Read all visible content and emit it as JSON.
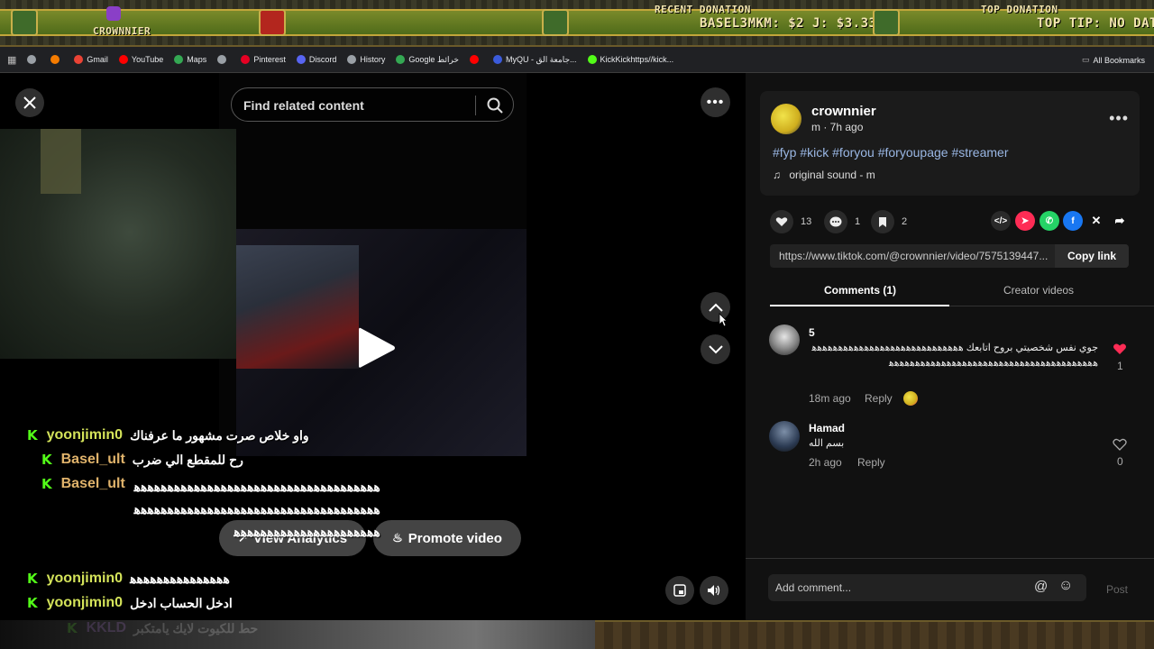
{
  "overlay": {
    "streamer_name": "CROWNNIER",
    "recent_donation_label": "RECENT DONATION",
    "recent_donation_value": "BASEL3MKM: $2    J: $3.33",
    "top_donation_label": "TOP DONATION",
    "top_donation_value": "TOP TIP: NO DATA"
  },
  "bookmarks": {
    "items": [
      {
        "label": "",
        "icon": "globe-icon",
        "color": "#9aa0a6"
      },
      {
        "label": "",
        "icon": "blogger-icon",
        "color": "#f57c00"
      },
      {
        "label": "Gmail",
        "icon": "gmail-icon",
        "color": "#ea4335"
      },
      {
        "label": "YouTube",
        "icon": "youtube-icon",
        "color": "#ff0000"
      },
      {
        "label": "Maps",
        "icon": "maps-icon",
        "color": "#34a853"
      },
      {
        "label": "",
        "icon": "globe-icon",
        "color": "#9aa0a6"
      },
      {
        "label": "Pinterest",
        "icon": "pinterest-icon",
        "color": "#e60023"
      },
      {
        "label": "Discord",
        "icon": "discord-icon",
        "color": "#5865f2"
      },
      {
        "label": "History",
        "icon": "history-icon",
        "color": "#9aa0a6"
      },
      {
        "label": "Google خرائط",
        "icon": "google-maps-icon",
        "color": "#34a853"
      },
      {
        "label": "",
        "icon": "youtube-icon",
        "color": "#ff0000"
      },
      {
        "label": "MyQU - جامعة الق...",
        "icon": "myqu-icon",
        "color": "#3b5bdb"
      },
      {
        "label": "KickKickhttps//kick...",
        "icon": "kick-icon",
        "color": "#53fc18"
      }
    ],
    "all_bookmarks": "All Bookmarks"
  },
  "player": {
    "search_placeholder": "Find related content",
    "view_analytics": "View Analytics",
    "promote_video": "Promote video"
  },
  "chat": [
    {
      "user": "yoonjimin0",
      "color": "#d4e35a",
      "message": "واو خلاص صرت مشهور ما عرفناك"
    },
    {
      "user": "Basel_ult",
      "color": "#e0b36b",
      "message": "رح للمقطع الي ضرب"
    },
    {
      "user": "Basel_ult",
      "color": "#e0b36b",
      "message": "ﻫﻫﻫﻫﻫﻫﻫﻫﻫﻫﻫﻫﻫﻫﻫﻫﻫﻫﻫﻫﻫﻫﻫﻫﻫﻫﻫﻫﻫﻫﻫﻫﻫﻫﻫﻫﻫﻫﻫﻫﻫﻫﻫﻫﻫﻫﻫﻫﻫﻫﻫﻫﻫﻫﻫﻫﻫﻫﻫﻫﻫﻫﻫﻫﻫﻫﻫﻫﻫﻫﻫﻫﻫﻫﻫﻫﻫﻫﻫﻫﻫﻫﻫﻫﻫﻫﻫﻫﻫﻫﻫﻫﻫﻫﻫﻫ"
    },
    {
      "user": "yoonjimin0",
      "color": "#d4e35a",
      "message": "ﻫﻫﻫﻫﻫﻫﻫﻫﻫﻫﻫﻫﻫﻫﻫ"
    },
    {
      "user": "yoonjimin0",
      "color": "#d4e35a",
      "message": "ادخل الحساب ادخل"
    },
    {
      "user": "KKLD",
      "color": "#c77dff",
      "message": "حط للكيوت لايك يامتكبر"
    }
  ],
  "post": {
    "username": "crownnier",
    "meta": "m · 7h ago",
    "hashtags": "#fyp #kick #foryou #foryoupage #streamer",
    "sound": "original sound - m",
    "likes": "13",
    "comments": "1",
    "saves": "2",
    "link": "https://www.tiktok.com/@crownnier/video/7575139447...",
    "copy_link": "Copy link"
  },
  "tabs": {
    "comments": "Comments (1)",
    "creator_videos": "Creator videos"
  },
  "comments": [
    {
      "name": "5",
      "text": "جوي نفس شخصيتي بروح اتابعك ﻫﻫﻫﻫﻫﻫﻫﻫﻫﻫﻫﻫﻫﻫﻫﻫﻫﻫﻫﻫﻫﻫﻫﻫﻫﻫﻫﻫﻫﻫﻫﻫﻫﻫﻫﻫﻫﻫﻫﻫﻫﻫﻫﻫﻫﻫﻫﻫﻫﻫﻫﻫﻫﻫﻫﻫﻫﻫﻫﻫﻫﻫﻫﻫﻫﻫﻫﻫﻫ",
      "time": "18m ago",
      "reply": "Reply",
      "likes": "1"
    },
    {
      "name": "Hamad",
      "text": "بسم الله",
      "time": "2h ago",
      "reply": "Reply",
      "likes": "0"
    }
  ],
  "compose": {
    "placeholder": "Add comment...",
    "post": "Post"
  }
}
